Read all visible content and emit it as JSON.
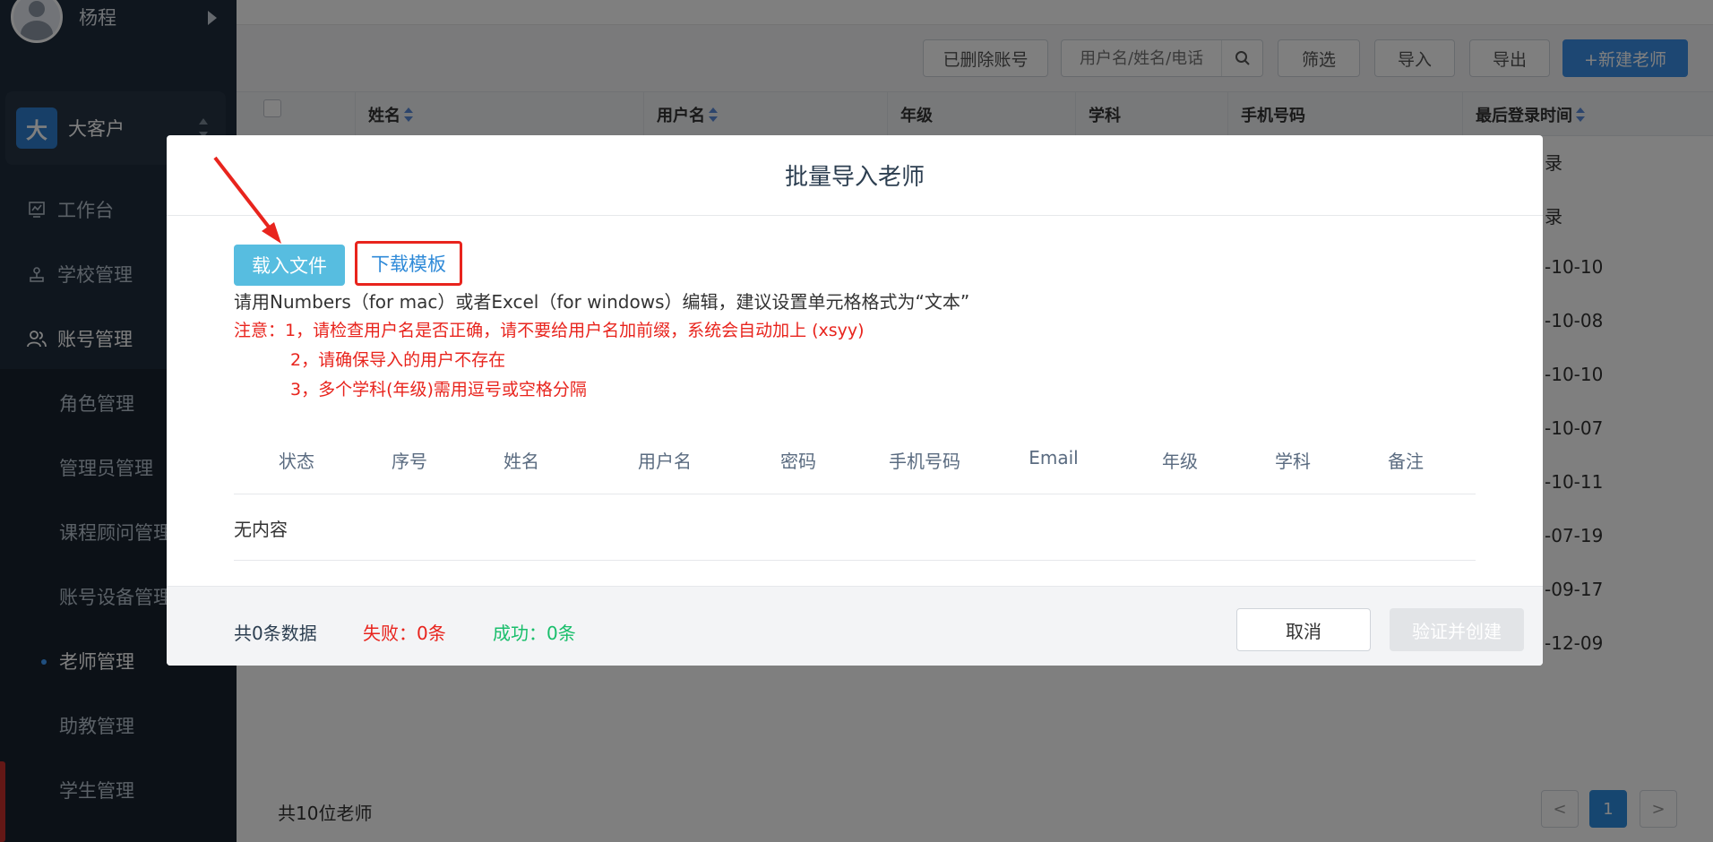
{
  "sidebar": {
    "user_name": "杨程",
    "org_logo": "大",
    "org_name": "大客户",
    "menu": [
      {
        "label": "工作台",
        "icon": "dashboard-icon"
      },
      {
        "label": "学校管理",
        "icon": "school-icon"
      },
      {
        "label": "账号管理",
        "icon": "account-icon"
      }
    ],
    "submenu": [
      {
        "label": "角色管理"
      },
      {
        "label": "管理员管理"
      },
      {
        "label": "课程顾问管理"
      },
      {
        "label": "账号设备管理"
      },
      {
        "label": "老师管理",
        "active": true
      },
      {
        "label": "助教管理"
      },
      {
        "label": "学生管理"
      }
    ]
  },
  "toolbar": {
    "deleted_accounts": "已删除账号",
    "search_placeholder": "用户名/姓名/电话",
    "filter": "筛选",
    "import": "导入",
    "export": "导出",
    "new_teacher": "+新建老师"
  },
  "table": {
    "headers": [
      "姓名",
      "用户名",
      "年级",
      "学科",
      "手机号码",
      "最后登录时间"
    ],
    "last_login_tails": [
      "录",
      "录",
      "-10-10",
      "-10-08",
      "-10-10",
      "-10-07",
      "-10-11",
      "-07-19",
      "-09-17",
      "-12-09"
    ],
    "footer_count": "共10位老师",
    "page": "1",
    "prev": "<",
    "next": ">"
  },
  "modal": {
    "title": "批量导入老师",
    "load_file": "载入文件",
    "download_template": "下载模板",
    "hint": "请用Numbers（for mac）或者Excel（for windows）编辑，建议设置单元格格式为“文本”",
    "note1": "注意：1，请检查用户名是否正确，请不要给用户名加前缀，系统会自动加上 (xsyy)",
    "note2": "2，请确保导入的用户不存在",
    "note3": "3，多个学科(年级)需用逗号或空格分隔",
    "columns": [
      "状态",
      "序号",
      "姓名",
      "用户名",
      "密码",
      "手机号码",
      "Email",
      "年级",
      "学科",
      "备注"
    ],
    "empty": "无内容",
    "total": "共0条数据",
    "failed": "失败：0条",
    "success": "成功：0条",
    "cancel": "取消",
    "verify": "验证并创建"
  },
  "colors": {
    "sidebar_bg": "#1f2d3d",
    "primary": "#3a8ee6",
    "load_btn": "#57bde0",
    "annotation_red": "#e8241d",
    "success_green": "#19be6b"
  }
}
